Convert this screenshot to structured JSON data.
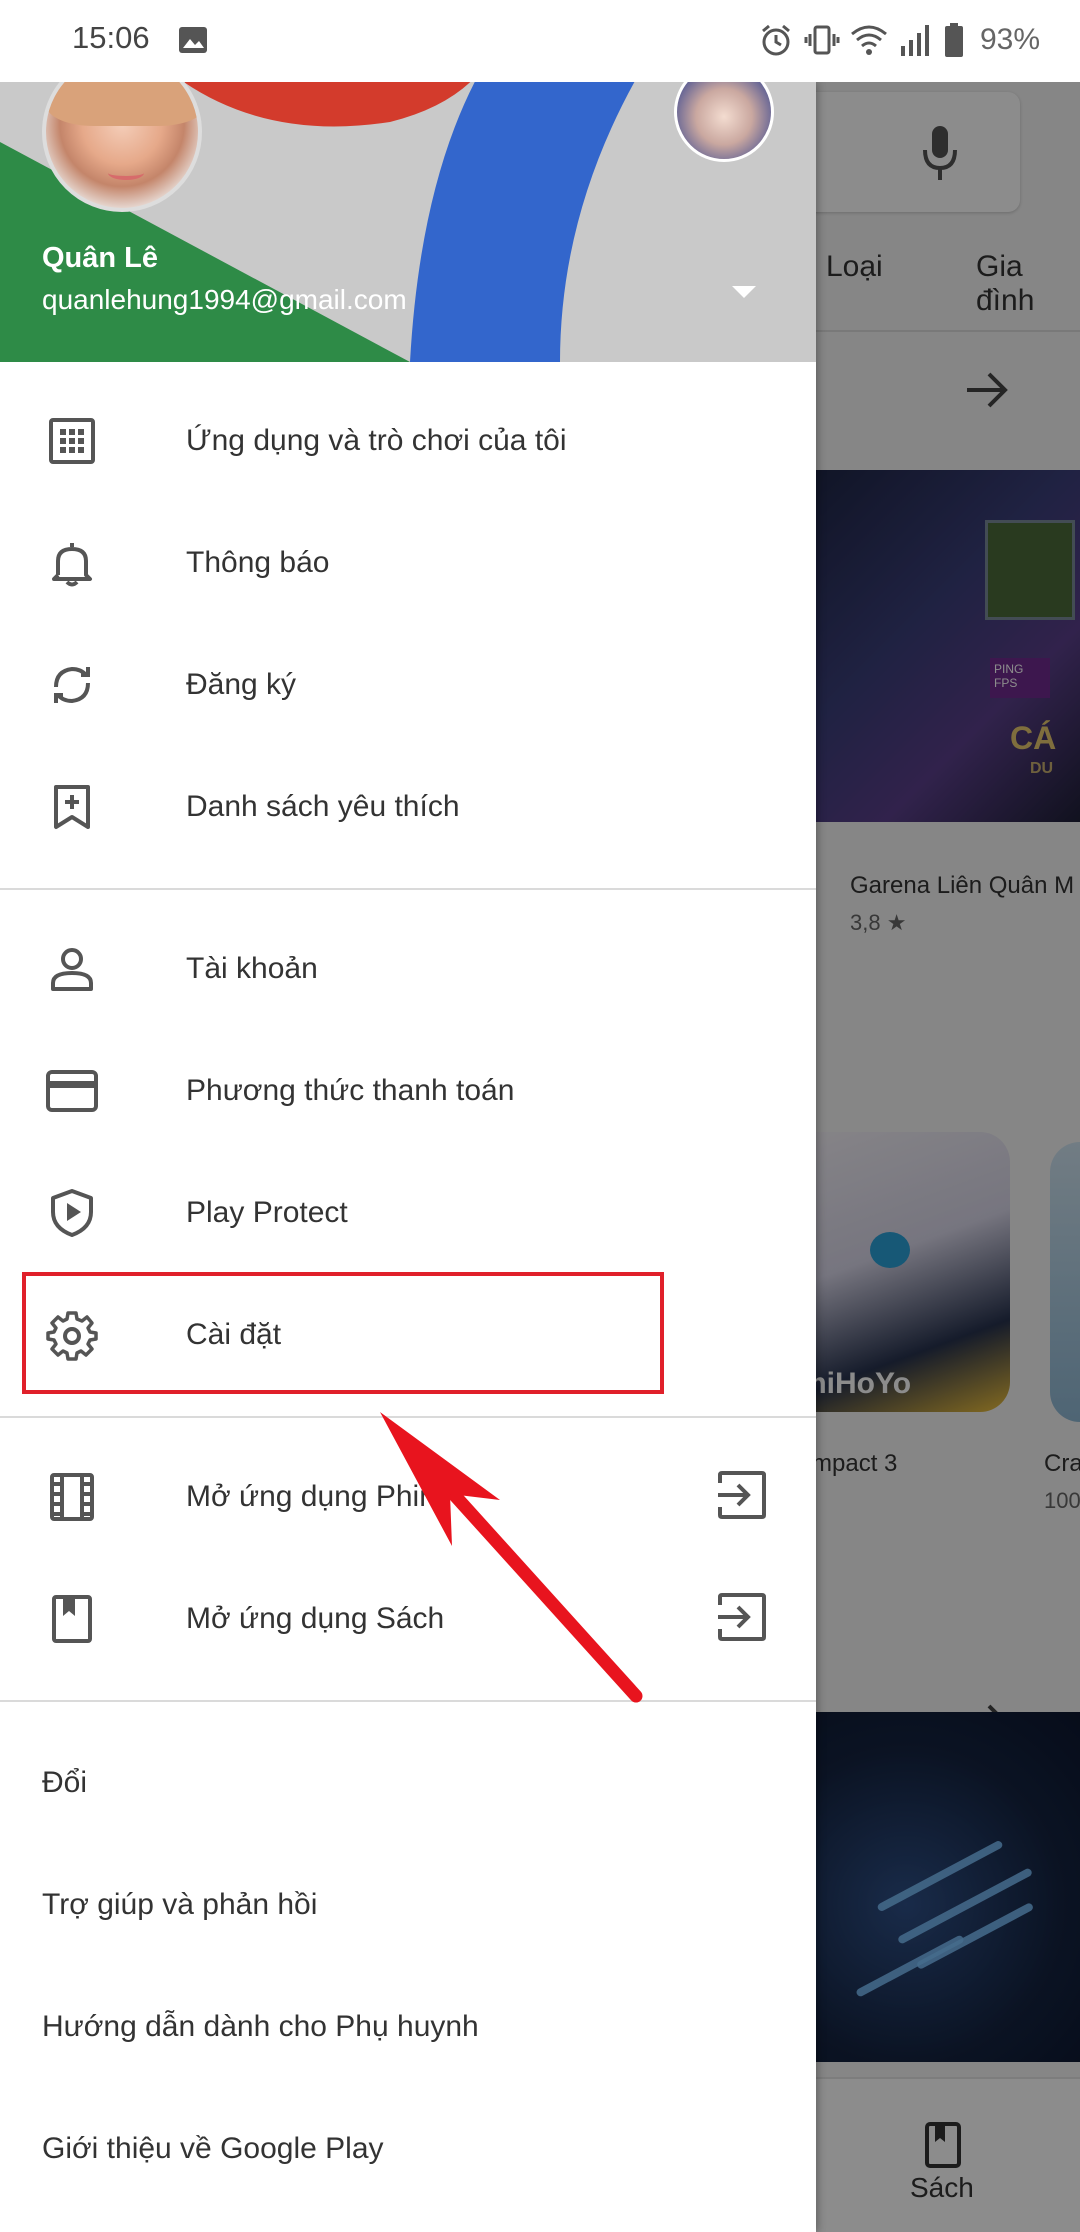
{
  "status_bar": {
    "time": "15:06",
    "battery": "93%",
    "icons": [
      "gallery-icon",
      "alarm-icon",
      "vibrate-icon",
      "wifi-icon",
      "signal-icon",
      "battery-icon"
    ]
  },
  "background_app": {
    "tabs": [
      "Loại",
      "Gia đình"
    ],
    "game_title": "Garena Liên Quân M",
    "game_rating": "3,8 ★",
    "game2_title": "mpact 3",
    "game3_title": "Cra",
    "game3_sub": "100",
    "banner_text": "CÁ",
    "banner_sub": "DU",
    "banner_ping": "PING FPS",
    "bottom_nav_label": "Sách"
  },
  "drawer": {
    "user_name": "Quân Lê",
    "user_email": "quanlehung1994@gmail.com",
    "section1": [
      {
        "label": "Ứng dụng và trò chơi của tôi",
        "icon": "apps-grid-icon"
      },
      {
        "label": "Thông báo",
        "icon": "bell-icon"
      },
      {
        "label": "Đăng ký",
        "icon": "sync-icon"
      },
      {
        "label": "Danh sách yêu thích",
        "icon": "bookmark-add-icon"
      }
    ],
    "section2": [
      {
        "label": "Tài khoản",
        "icon": "person-icon"
      },
      {
        "label": "Phương thức thanh toán",
        "icon": "credit-card-icon"
      },
      {
        "label": "Play Protect",
        "icon": "shield-play-icon"
      },
      {
        "label": "Cài đặt",
        "icon": "gear-icon"
      }
    ],
    "section3": [
      {
        "label": "Mở ứng dụng Phim",
        "icon": "film-icon"
      },
      {
        "label": "Mở ứng dụng Sách",
        "icon": "book-icon"
      }
    ],
    "section4": [
      {
        "label": "Đổi"
      },
      {
        "label": "Trợ giúp và phản hồi"
      },
      {
        "label": "Hướng dẫn dành cho Phụ huynh"
      },
      {
        "label": "Giới thiệu về Google Play"
      }
    ]
  },
  "colors": {
    "highlight": "#e0202a",
    "arrow": "#e8141e",
    "header_green": "#2e8b47",
    "header_blue": "#3366cc",
    "header_red": "#d33b2c"
  }
}
